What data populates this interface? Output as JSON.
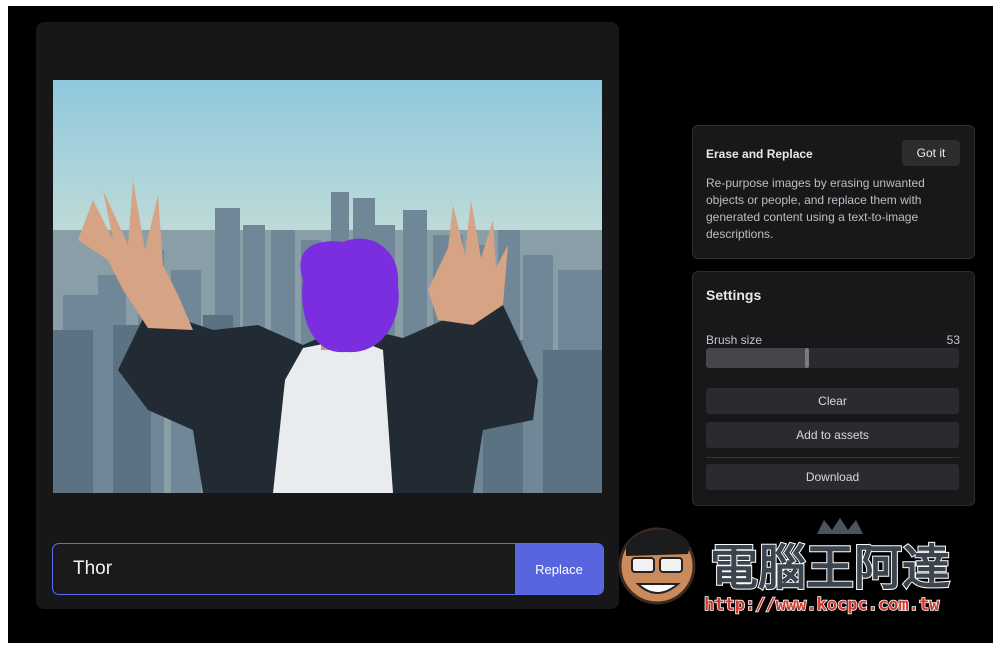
{
  "prompt": {
    "value": "Thor",
    "replace_label": "Replace"
  },
  "info_panel": {
    "title": "Erase and Replace",
    "got_it_label": "Got it",
    "description": "Re-purpose images by erasing unwanted objects or people, and replace them with generated content using a text-to-image descriptions."
  },
  "settings": {
    "title": "Settings",
    "brush_size_label": "Brush size",
    "brush_size_value": "53",
    "brush_fraction": 0.4,
    "clear_label": "Clear",
    "add_to_assets_label": "Add to assets",
    "download_label": "Download"
  },
  "watermark": {
    "name": "電腦王阿達",
    "url": "http://www.kocpc.com.tw"
  },
  "colors": {
    "accent": "#5965df",
    "mask": "#7b2ee0",
    "background": "#000000",
    "panel": "#18181a"
  }
}
